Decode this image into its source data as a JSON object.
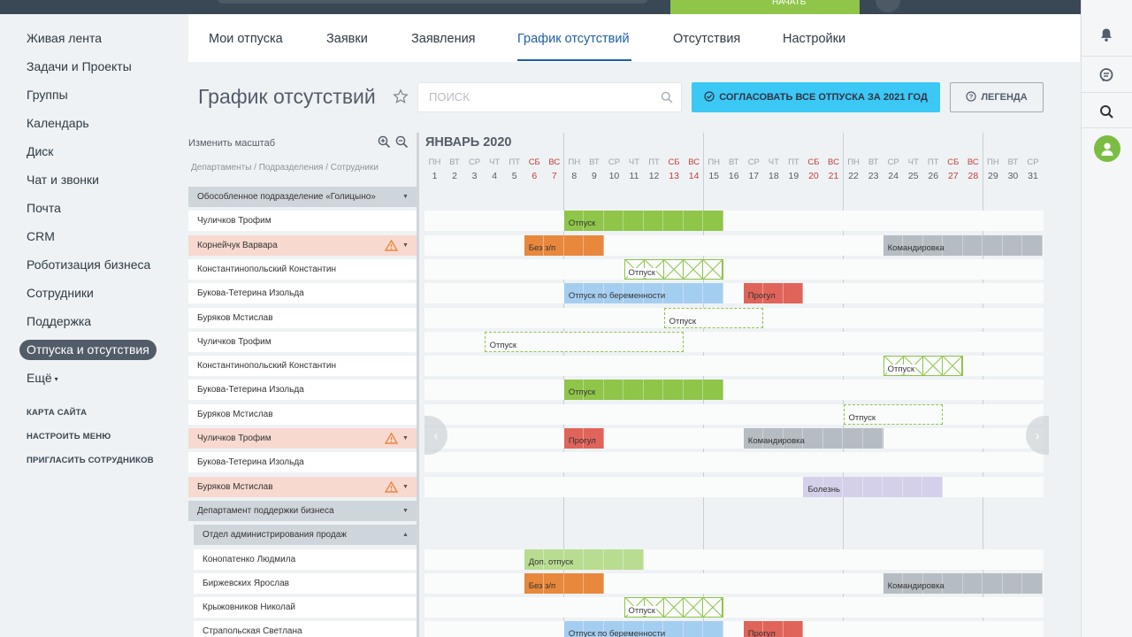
{
  "topbar": {
    "green_button_label": "НАЧАТЬ"
  },
  "sidebar": {
    "items": [
      {
        "label": "Живая лента"
      },
      {
        "label": "Задачи и Проекты"
      },
      {
        "label": "Группы"
      },
      {
        "label": "Календарь"
      },
      {
        "label": "Диск"
      },
      {
        "label": "Чат и звонки"
      },
      {
        "label": "Почта"
      },
      {
        "label": "CRM"
      },
      {
        "label": "Роботизация бизнеса"
      },
      {
        "label": "Сотрудники"
      },
      {
        "label": "Поддержка"
      },
      {
        "label": "Отпуска и отсутствия",
        "active": true
      },
      {
        "label": "Ещё"
      }
    ],
    "links": [
      "КАРТА САЙТА",
      "НАСТРОИТЬ МЕНЮ",
      "ПРИГЛАСИТЬ СОТРУДНИКОВ"
    ]
  },
  "tabs": [
    {
      "label": "Мои отпуска"
    },
    {
      "label": "Заявки"
    },
    {
      "label": "Заявления"
    },
    {
      "label": "График отсутствий",
      "active": true
    },
    {
      "label": "Отсутствия"
    },
    {
      "label": "Настройки"
    }
  ],
  "page": {
    "title": "График отсутствий",
    "search_placeholder": "поиск",
    "approve_button": "СОГЛАСОВАТЬ ВСЕ ОТПУСКА ЗА 2021 ГОД",
    "legend_button": "ЛЕГЕНДА"
  },
  "grid": {
    "scale_label": "Изменить масштаб",
    "breadcrumb": "Департаменты / Подразделения / Сотрудники",
    "month": "ЯНВАРЬ 2020",
    "days": [
      {
        "dow": "ПН",
        "num": "1"
      },
      {
        "dow": "ВТ",
        "num": "2"
      },
      {
        "dow": "СР",
        "num": "3"
      },
      {
        "dow": "ЧТ",
        "num": "4"
      },
      {
        "dow": "ПТ",
        "num": "5"
      },
      {
        "dow": "СБ",
        "num": "6",
        "we": true
      },
      {
        "dow": "ВС",
        "num": "7",
        "we": true
      },
      {
        "dow": "ПН",
        "num": "8"
      },
      {
        "dow": "ВТ",
        "num": "9"
      },
      {
        "dow": "СР",
        "num": "10"
      },
      {
        "dow": "ЧТ",
        "num": "11"
      },
      {
        "dow": "ПТ",
        "num": "12"
      },
      {
        "dow": "СБ",
        "num": "13",
        "we": true
      },
      {
        "dow": "ВС",
        "num": "14",
        "we": true
      },
      {
        "dow": "ПН",
        "num": "15"
      },
      {
        "dow": "ВТ",
        "num": "16"
      },
      {
        "dow": "СР",
        "num": "17"
      },
      {
        "dow": "ЧТ",
        "num": "18"
      },
      {
        "dow": "ПТ",
        "num": "19"
      },
      {
        "dow": "СБ",
        "num": "20",
        "we": true
      },
      {
        "dow": "ВС",
        "num": "21",
        "we": true
      },
      {
        "dow": "ПН",
        "num": "22"
      },
      {
        "dow": "ВТ",
        "num": "23"
      },
      {
        "dow": "СР",
        "num": "24"
      },
      {
        "dow": "ЧТ",
        "num": "25"
      },
      {
        "dow": "ПТ",
        "num": "26"
      },
      {
        "dow": "СБ",
        "num": "27",
        "we": true
      },
      {
        "dow": "ВС",
        "num": "28",
        "we": true
      },
      {
        "dow": "ПН",
        "num": "29"
      },
      {
        "dow": "ВТ",
        "num": "30"
      },
      {
        "dow": "СР",
        "num": "31"
      }
    ],
    "rows": [
      {
        "name": "Обособленное подразделение «Голицыно»",
        "kind": "group",
        "caret": "▼",
        "bars": []
      },
      {
        "name": "Чуличков Трофим",
        "kind": "plain",
        "bars": [
          {
            "type": "green",
            "start": 8,
            "end": 15,
            "label": "Отпуск"
          }
        ]
      },
      {
        "name": "Корнейчук Варвара",
        "kind": "warn",
        "bars": [
          {
            "type": "orange",
            "start": 6,
            "end": 9,
            "label": "Без з/п"
          },
          {
            "type": "grey",
            "start": 24,
            "end": 31,
            "label": "Командировка"
          }
        ]
      },
      {
        "name": "Константинопольский Константин",
        "kind": "plain",
        "bars": [
          {
            "type": "xbox",
            "start": 11,
            "end": 15,
            "label": "Отпуск"
          }
        ]
      },
      {
        "name": "Букова-Тетерина Изольда",
        "kind": "plain",
        "bars": [
          {
            "type": "blue",
            "start": 8,
            "end": 15,
            "label": "Отпуск по беременности"
          },
          {
            "type": "red",
            "start": 17,
            "end": 19,
            "label": "Прогул"
          }
        ]
      },
      {
        "name": "Буряков Мстислав",
        "kind": "plain",
        "bars": [
          {
            "type": "dashed",
            "start": 13,
            "end": 17,
            "label": "Отпуск"
          }
        ]
      },
      {
        "name": "Чуличков Трофим",
        "kind": "plain",
        "bars": [
          {
            "type": "dashed",
            "start": 4,
            "end": 13,
            "label": "Отпуск"
          }
        ]
      },
      {
        "name": "Константинопольский Константин",
        "kind": "plain",
        "bars": [
          {
            "type": "xbox",
            "start": 24,
            "end": 27,
            "label": "Отпуск"
          }
        ]
      },
      {
        "name": "Букова-Тетерина Изольда",
        "kind": "plain",
        "bars": [
          {
            "type": "green",
            "start": 8,
            "end": 15,
            "label": "Отпуск"
          }
        ]
      },
      {
        "name": "Буряков Мстислав",
        "kind": "plain",
        "bars": [
          {
            "type": "dashed",
            "start": 22,
            "end": 26,
            "label": "Отпуск"
          }
        ]
      },
      {
        "name": "Чуличков Трофим",
        "kind": "warn",
        "bars": [
          {
            "type": "red",
            "start": 8,
            "end": 9,
            "label": "Прогул"
          },
          {
            "type": "grey",
            "start": 17,
            "end": 23,
            "label": "Командировка"
          }
        ]
      },
      {
        "name": "Букова-Тетерина Изольда",
        "kind": "plain",
        "bars": []
      },
      {
        "name": "Буряков Мстислав",
        "kind": "warn",
        "bars": [
          {
            "type": "lilac",
            "start": 20,
            "end": 26,
            "label": "Болезнь"
          }
        ]
      },
      {
        "name": "Департамент поддержки бизнеса",
        "kind": "group",
        "caret": "▼",
        "bars": []
      },
      {
        "name": "Отдел администрирования продаж",
        "kind": "group",
        "indent": true,
        "caret": "▲",
        "bars": []
      },
      {
        "name": "Конопатенко Людмила",
        "kind": "plain",
        "indent": true,
        "bars": [
          {
            "type": "lightgreen",
            "start": 6,
            "end": 11,
            "label": "Доп. отпуск"
          }
        ]
      },
      {
        "name": "Биржевских Ярослав",
        "kind": "plain",
        "indent": true,
        "bars": [
          {
            "type": "orange",
            "start": 6,
            "end": 9,
            "label": "Без з/п"
          },
          {
            "type": "grey",
            "start": 24,
            "end": 31,
            "label": "Командировка"
          }
        ]
      },
      {
        "name": "Крыжовников Николай",
        "kind": "plain",
        "indent": true,
        "bars": [
          {
            "type": "xbox",
            "start": 11,
            "end": 15,
            "label": "Отпуск"
          }
        ]
      },
      {
        "name": "Страпольская Светлана",
        "kind": "plain",
        "indent": true,
        "bars": [
          {
            "type": "blue",
            "start": 8,
            "end": 15,
            "label": "Отпуск по беременности"
          },
          {
            "type": "red",
            "start": 17,
            "end": 19,
            "label": "Прогул"
          }
        ]
      }
    ]
  },
  "colors": {
    "green": "#8fc549",
    "lightgreen": "#b8dd91",
    "orange": "#e8883c",
    "grey": "#b5bcc2",
    "blue": "#a4cef0",
    "red": "#e0645a",
    "lilac": "#d4d0ea",
    "accent": "#3bc8f5",
    "active_tab": "#1d5ea8"
  }
}
